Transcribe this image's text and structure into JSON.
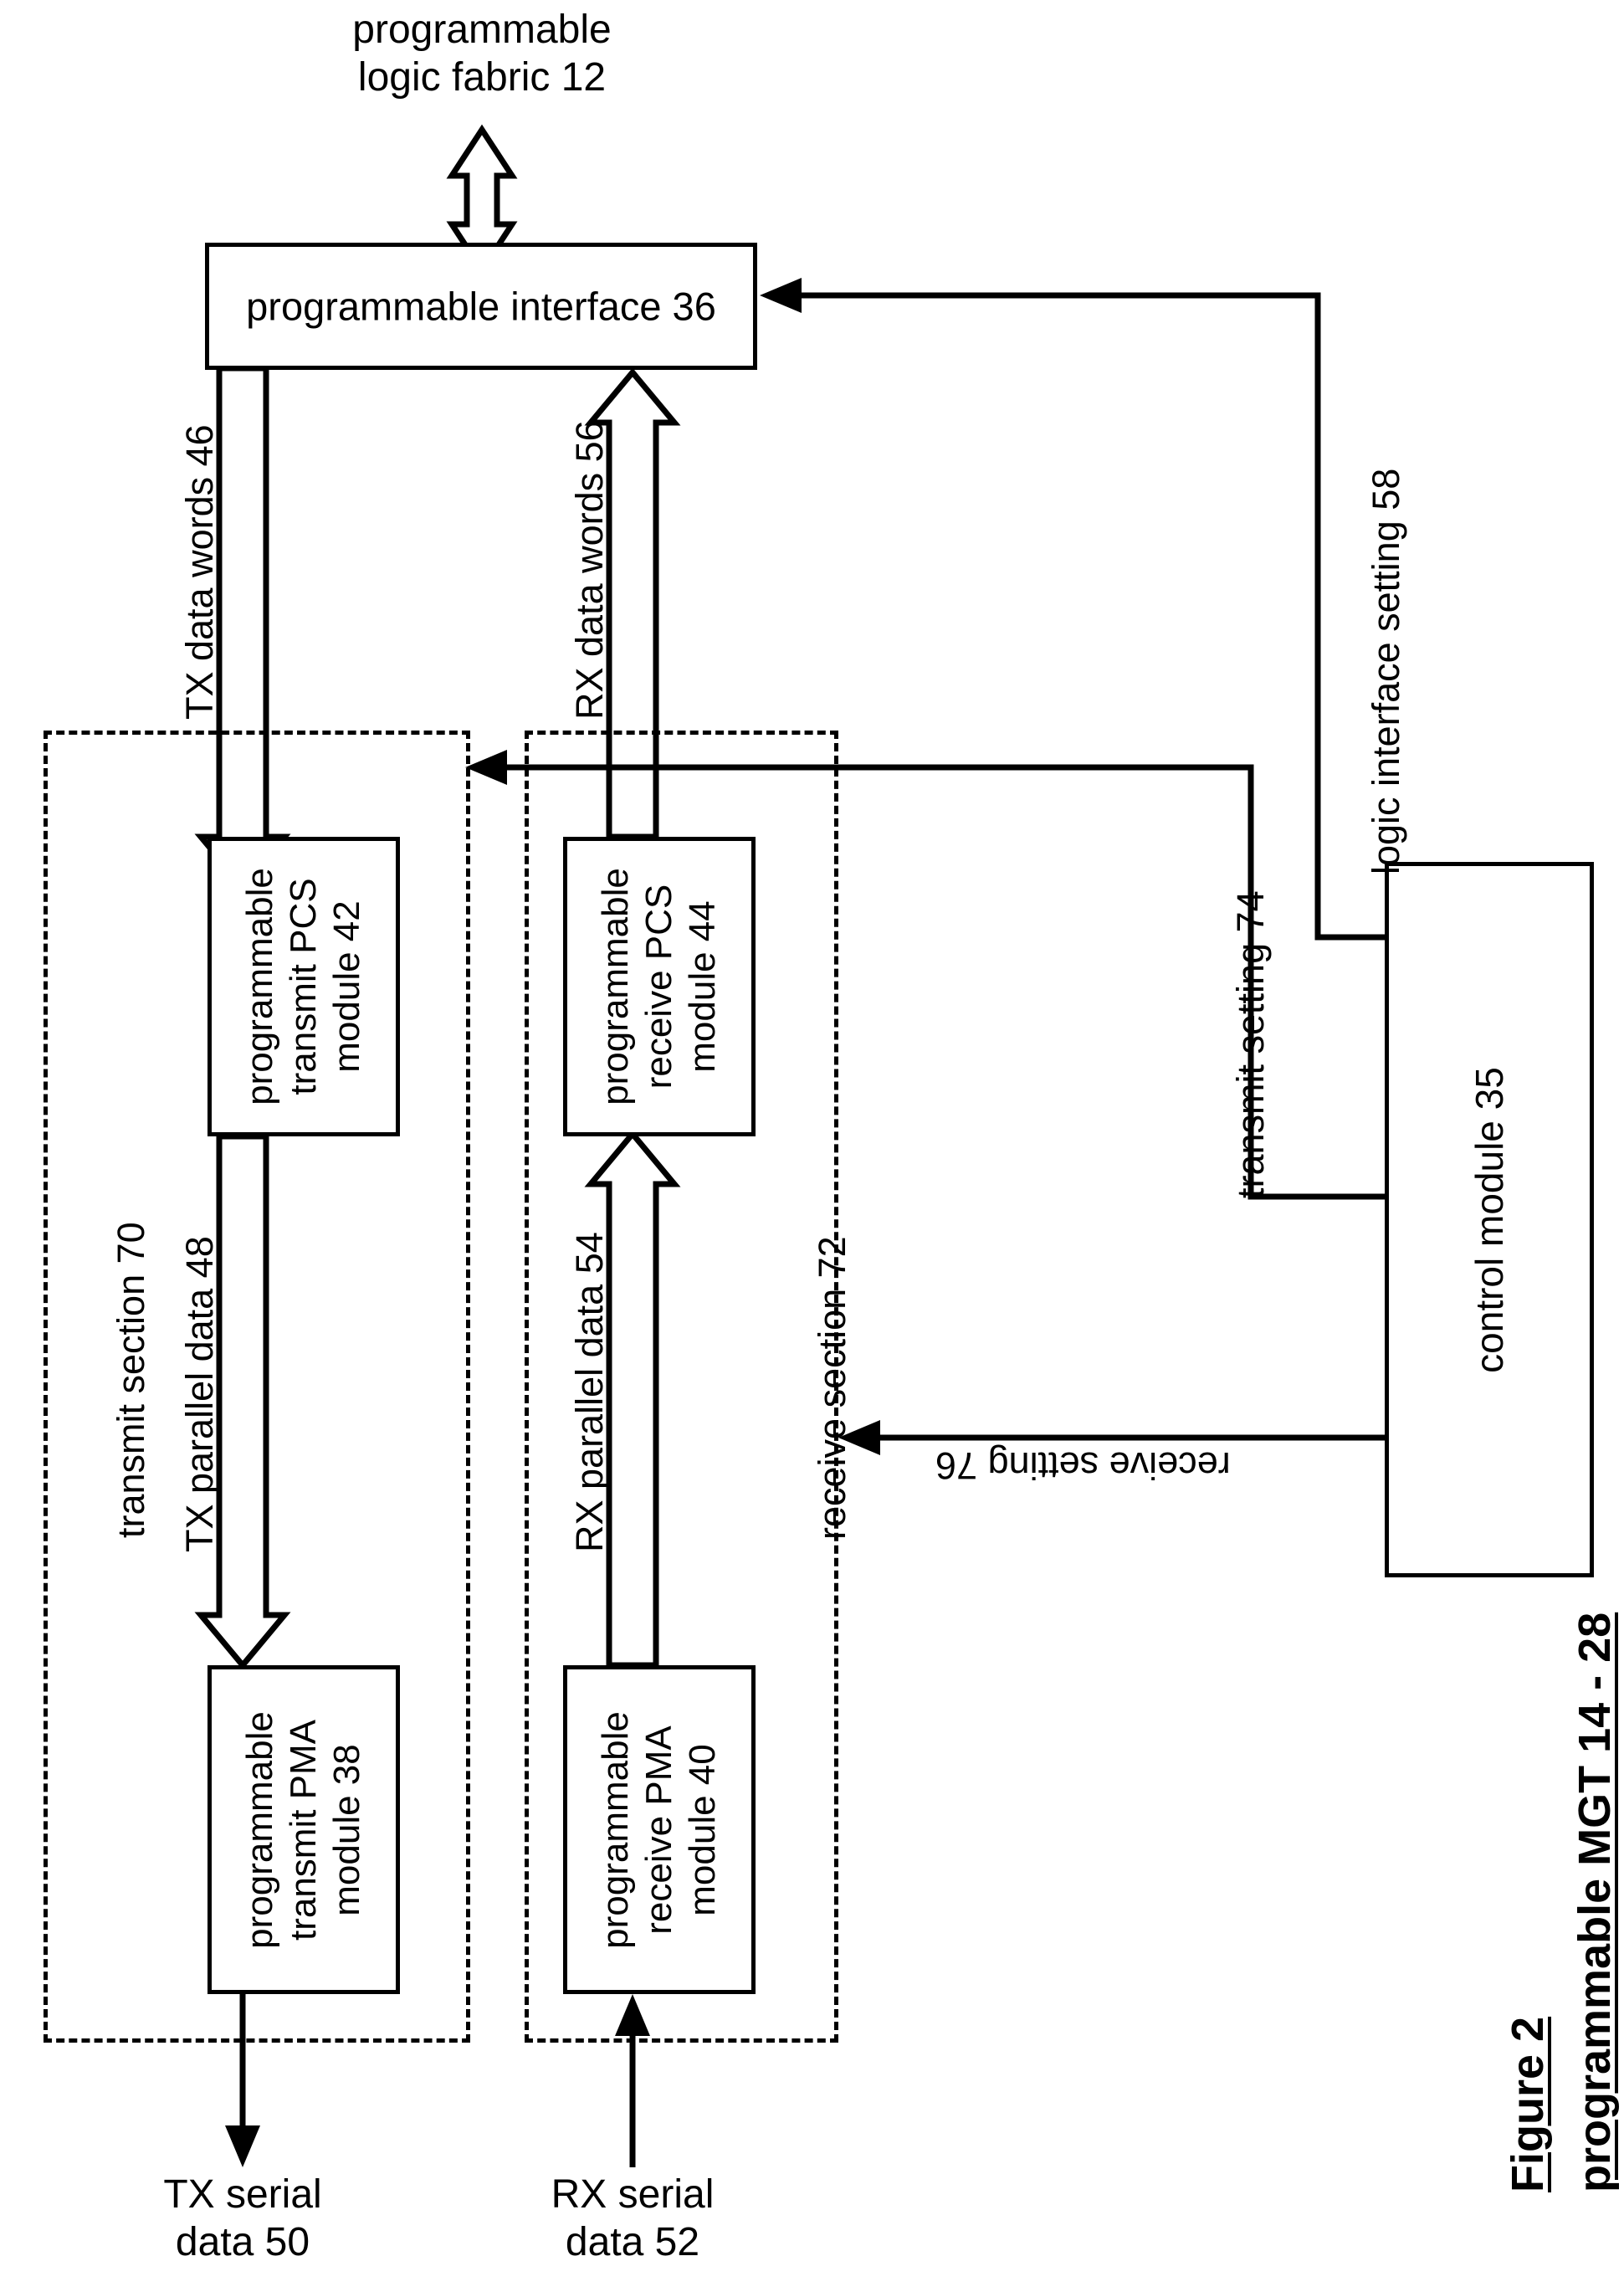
{
  "figure": {
    "caption_line1": "Figure 2",
    "caption_line2": "programmable MGT 14 - 28"
  },
  "nodes": {
    "logic_fabric": "programmable\nlogic fabric 12",
    "prog_interface": "programmable interface 36",
    "tx_pcs": "programmable\ntransmit PCS\nmodule 42",
    "rx_pcs": "programmable\nreceive PCS\nmodule 44",
    "tx_pma": "programmable\ntransmit PMA\nmodule 38",
    "rx_pma": "programmable\nreceive PMA\nmodule 40",
    "control_module": "control module 35"
  },
  "sections": {
    "transmit": "transmit section 70",
    "receive": "receive section 72"
  },
  "signals": {
    "tx_data_words": "TX data words 46",
    "rx_data_words": "RX data words 56",
    "tx_parallel_data": "TX parallel data 48",
    "rx_parallel_data": "RX parallel data 54",
    "tx_serial_data": "TX serial\ndata 50",
    "rx_serial_data": "RX serial\ndata 52",
    "logic_interface_setting": "logic interface setting 58",
    "transmit_setting": "transmit setting 74",
    "receive_setting": "receive setting 76"
  },
  "colors": {
    "ink": "#000000",
    "paper": "#ffffff"
  }
}
